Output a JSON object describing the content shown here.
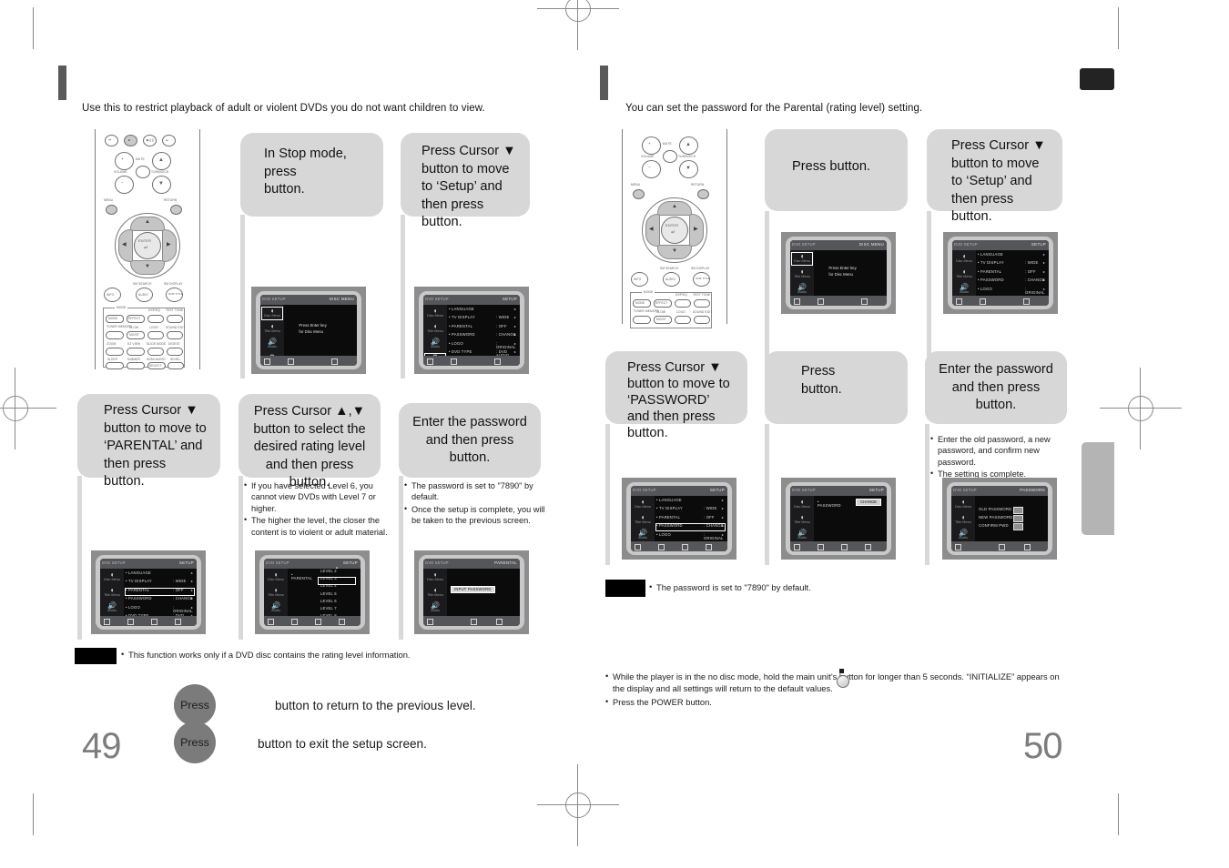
{
  "document": {
    "type": "dvd-player-user-manual-spread",
    "left_page": {
      "page_number": "49",
      "intro": "Use this to restrict playback of adult or violent DVDs you do not want children to view.",
      "steps": [
        {
          "id": "step1",
          "text": "In Stop mode, press\nbutton."
        },
        {
          "id": "step2",
          "text": "Press Cursor ▼ button to move to ‘Setup’ and then press            button."
        },
        {
          "id": "step3",
          "text": "Press Cursor ▼ button to move to ‘PARENTAL’ and then press            button."
        },
        {
          "id": "step4",
          "text": "Press Cursor ▲,▼ button to select the desired rating level and then press button."
        },
        {
          "id": "step5",
          "text": "Enter the password and then press button."
        }
      ],
      "step4_notes": [
        "If you have selected Level 6, you cannot view DVDs with Level 7 or higher.",
        "The higher the level, the closer the content is to violent or adult material."
      ],
      "step5_notes": [
        "The password is set to \"7890\" by default.",
        "Once the setup is complete, you will be taken to the previous screen."
      ],
      "chip_note": "This function works only if a DVD disc contains the rating level information.",
      "press_rows": [
        {
          "pill": "Press",
          "text": "button to return to the previous level."
        },
        {
          "pill": "Press",
          "text": "button to exit the setup screen."
        }
      ]
    },
    "right_page": {
      "page_number": "50",
      "intro": "You can set the password for the Parental (rating level) setting.",
      "steps": [
        {
          "id": "rstep1",
          "text": "Press            button."
        },
        {
          "id": "rstep2",
          "text": "Press Cursor ▼ button to move to ‘Setup’ and then press            button."
        },
        {
          "id": "rstep3",
          "text": "Press Cursor ▼ button to move to ‘PASSWORD’ and then press button."
        },
        {
          "id": "rstep4",
          "text": "Press\nbutton."
        },
        {
          "id": "rstep5",
          "text": "Enter the password and then press button."
        }
      ],
      "rstep5_notes": [
        "Enter the old password, a new password, and confirm new password.",
        "The setting is complete."
      ],
      "chip_note": "The password is set to \"7890\" by default.",
      "footnotes": [
        "While the player is in the no disc mode, hold the main unit’s          button for longer than 5 seconds. “INITIALIZE” appears on the display and all settings will return to the default values.",
        "Press the POWER button."
      ]
    }
  },
  "tv_screens": {
    "disc_menu": {
      "header_left": "DVD SETUP",
      "header_right": "DISC MENU",
      "center_line1": "Press Enter key",
      "center_line2": "for Disc Menu",
      "rail": [
        "Disc Menu",
        "Title Menu",
        "Audio",
        "Setup"
      ],
      "rail_selected": 0
    },
    "setup_main_setup_selected": {
      "header_left": "DVD SETUP",
      "header_right": "SETUP",
      "rail": [
        "Disc Menu",
        "Title Menu",
        "Audio",
        "Setup"
      ],
      "rail_selected": 3,
      "rows": [
        {
          "key": "LANGUAGE",
          "value": ""
        },
        {
          "key": "TV  DISPLAY",
          "value": ": WIDE"
        },
        {
          "key": "PARENTAL",
          "value": ": OFF"
        },
        {
          "key": "PASSWORD",
          "value": ": CHANGE"
        },
        {
          "key": "LOGO",
          "value": ": ORIGINAL"
        },
        {
          "key": "DVD TYPE",
          "value": ": DVD AUDIO"
        }
      ],
      "row_selected": -1
    },
    "setup_parental_selected": {
      "header_left": "DVD SETUP",
      "header_right": "SETUP",
      "rail": [
        "Disc Menu",
        "Title Menu",
        "Audio",
        "Setup"
      ],
      "rail_selected": 3,
      "rows": [
        {
          "key": "LANGUAGE",
          "value": ""
        },
        {
          "key": "TV  DISPLAY",
          "value": ": WIDE"
        },
        {
          "key": "PARENTAL",
          "value": ": OFF"
        },
        {
          "key": "PASSWORD",
          "value": ": CHANGE"
        },
        {
          "key": "LOGO",
          "value": ": ORIGINAL"
        },
        {
          "key": "DVD TYPE",
          "value": ": DVD AUDIO"
        }
      ],
      "row_selected": 2
    },
    "setup_password_selected": {
      "header_left": "DVD SETUP",
      "header_right": "SETUP",
      "rail": [
        "Disc Menu",
        "Title Menu",
        "Audio",
        "Setup"
      ],
      "rail_selected": 3,
      "rows": [
        {
          "key": "LANGUAGE",
          "value": ""
        },
        {
          "key": "TV  DISPLAY",
          "value": ": WIDE"
        },
        {
          "key": "PARENTAL",
          "value": ": OFF"
        },
        {
          "key": "PASSWORD",
          "value": ": CHANGE"
        },
        {
          "key": "LOGO",
          "value": ": ORIGINAL"
        },
        {
          "key": "DVD TYPE",
          "value": ": DVD AUDIO"
        }
      ],
      "row_selected": 3
    },
    "rating_levels": {
      "header_left": "DVD SETUP",
      "header_right": "SETUP",
      "rail": [
        "Disc Menu",
        "Title Menu",
        "Audio",
        "Setup"
      ],
      "label": "PARENTAL",
      "levels": [
        "LEVEL 2",
        "LEVEL 3",
        "LEVEL 4",
        "LEVEL 5",
        "LEVEL 6",
        "LEVEL 7",
        "LEVEL 8"
      ],
      "level_selected": 1
    },
    "input_password": {
      "header_left": "DVD SETUP",
      "header_right": "PARENTAL",
      "rail": [
        "Disc Menu",
        "Title Menu",
        "Audio",
        "Setup"
      ],
      "input_label": "INPUT PASSWORD"
    },
    "password_change": {
      "header_left": "DVD SETUP",
      "header_right": "SETUP",
      "rail": [
        "Disc Menu",
        "Title Menu",
        "Audio",
        "Setup"
      ],
      "label": "PASSWORD",
      "value_box": "CHANGE"
    },
    "password_fields": {
      "header_left": "DVD SETUP",
      "header_right": "PASSWORD",
      "rail": [
        "Disc Menu",
        "Title Menu",
        "Audio",
        "Setup"
      ],
      "fields": [
        "OLD PASSWORD",
        "NEW PASSWORD",
        "CONFIRM PWD"
      ]
    }
  },
  "remote": {
    "labels": {
      "volume": "VOLUME",
      "mute": "MUTE",
      "tuning": "TUNING/CH",
      "menu": "MENU",
      "return": "RETURN",
      "enter": "ENTER",
      "info": "INFO",
      "audio": "AUDIO",
      "subtitle": "SUB TITLE",
      "sm_search": "SM SEARCH",
      "sm_display": "SM DISPLAY",
      "mode_group": "MODE",
      "mode": "MODE",
      "effect": "EFFECT",
      "dsp_eq": "DSP/EQ",
      "test_tone": "TEST TONE",
      "tuner_memory": "TUNER MEMORY",
      "slow": "SLOW",
      "logo": "LOGO",
      "sound_edit": "SOUND EDIT",
      "mo_st": "MO/ST",
      "zoom": "ZOOM",
      "ez_view": "EZ VIEW",
      "slide_mode": "SLIDE MODE",
      "digest": "DIGEST",
      "sleep": "SLEEP",
      "dimmer": "DIMMER",
      "hdmi_audio": "HDMI AUDIO",
      "sd_hd": "SD/HD",
      "select": "SELECT"
    }
  },
  "colors": {
    "bubble_bg": "#d7d7d7",
    "section_marker": "#5a5a5a",
    "page_number": "#7d7d7d",
    "pill": "#7b7b7b",
    "tab_black": "#232323",
    "tab_gray": "#b4b4b4"
  }
}
